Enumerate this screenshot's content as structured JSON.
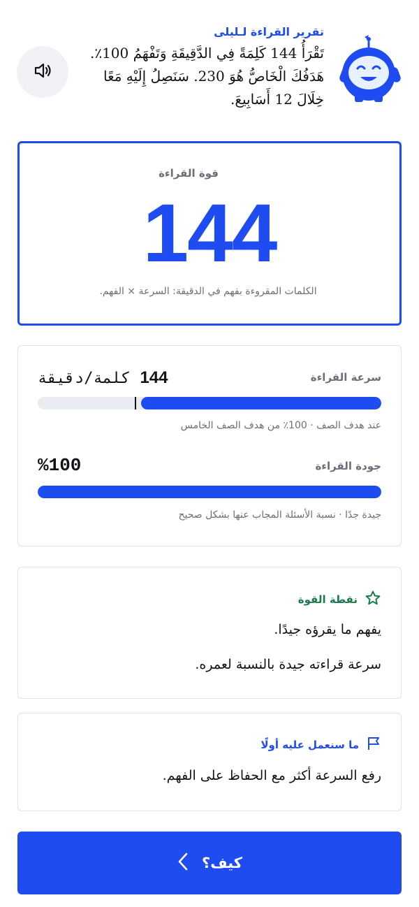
{
  "header": {
    "title": "تقرير القراءة لـليلى",
    "message_lines": [
      "تَقْرَأُ 144 كَلِمَةً فِي الدَّقِيقَةِ وَتَفْهَمُ 100٪.",
      "هَدَفُكَ الْخَاصُّ هُوَ 230. سَنَصِلُ إِلَيْهِ مَعًا",
      "خِلَالَ 12 أَسَابِيعَ."
    ],
    "speaker_icon": "speaker-icon",
    "mascot_icon": "robot-mascot-icon"
  },
  "power": {
    "label": "قوة القراءة",
    "value": "144",
    "subtitle": "الكلمات المقروءة بفهم في الدقيقة: السرعة × الفهم."
  },
  "speed": {
    "label": "سرعة القراءة",
    "value": "144",
    "unit": "كلمة/دقيقة",
    "progress_fraction": 0.7,
    "target_marker_fraction": 0.282,
    "note": "عند هدف الصف · 100٪ من هدف الصف الخامس"
  },
  "quality": {
    "label": "جودة القراءة",
    "value": "%100",
    "progress_fraction": 1.0,
    "note": "جيدة جدًا · نسبة الأسئلة المجاب عنها بشكل صحيح"
  },
  "strength": {
    "title": "نقطة القوة",
    "icon": "star-icon",
    "lines": [
      "يفهم ما يقرؤه جيدًا.",
      "سرعة قراءته جيدة بالنسبة لعمره."
    ]
  },
  "focus": {
    "title": "ما سنعمل عليه أولًا",
    "icon": "flag-icon",
    "lines": [
      "رفع السرعة أكثر مع الحفاظ على الفهم."
    ]
  },
  "cta": {
    "label": "كيف؟",
    "icon": "chevron-left-icon"
  },
  "colors": {
    "primary": "#1f4cf0",
    "success": "#1b7a4d",
    "muted": "#6b6f78",
    "track": "#e9ecf1"
  }
}
